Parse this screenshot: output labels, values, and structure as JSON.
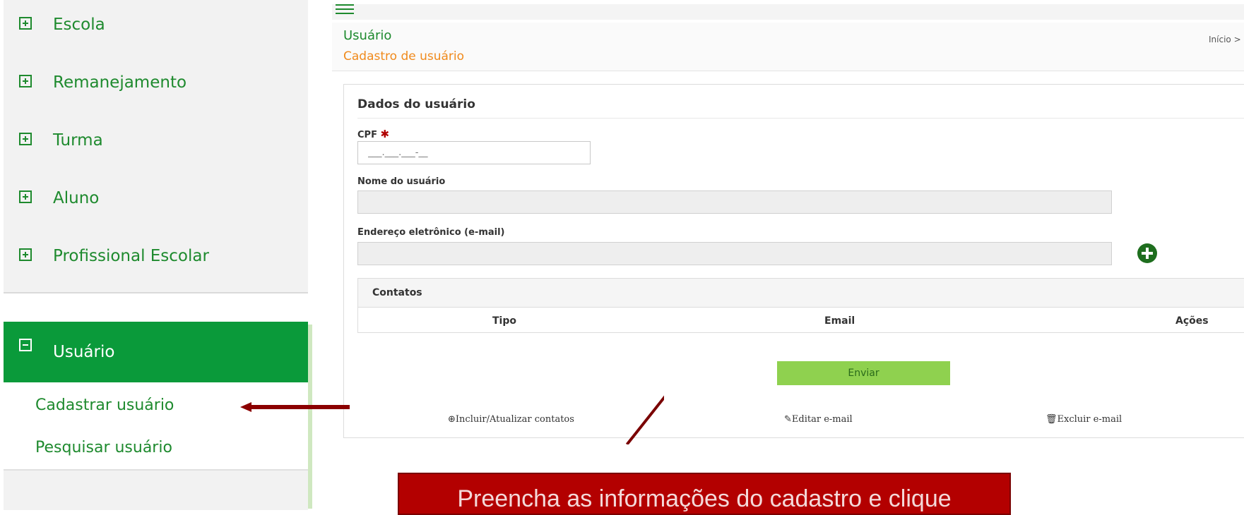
{
  "sidebar": {
    "items": [
      {
        "label": "Escola",
        "icon": "plus-square-icon"
      },
      {
        "label": "Remanejamento",
        "icon": "plus-square-icon"
      },
      {
        "label": "Turma",
        "icon": "plus-square-icon"
      },
      {
        "label": "Aluno",
        "icon": "plus-square-icon"
      },
      {
        "label": "Profissional Escolar",
        "icon": "plus-square-icon"
      },
      {
        "label": "Usuário",
        "icon": "minus-square-icon",
        "active": true
      }
    ],
    "submenu": [
      {
        "label": "Cadastrar usuário"
      },
      {
        "label": "Pesquisar usuário"
      }
    ]
  },
  "header": {
    "title": "Usuário",
    "subtitle": "Cadastro de usuário",
    "breadcrumb": "Início >"
  },
  "form": {
    "section_title": "Dados do usuário",
    "cpf_label": "CPF",
    "cpf_required_mark": "✱",
    "cpf_mask": "___.___.___-__",
    "name_label": "Nome do usuário",
    "email_label": "Endereço eletrônico (e-mail)"
  },
  "contacts": {
    "title": "Contatos",
    "columns": [
      "Tipo",
      "Email",
      "Ações"
    ]
  },
  "buttons": {
    "submit_label": "Enviar"
  },
  "actions": [
    {
      "icon": "plus-circle-icon",
      "label": "Incluir/Atualizar contatos"
    },
    {
      "icon": "pencil-icon",
      "label": "Editar e-mail"
    },
    {
      "icon": "trash-icon",
      "label": "Excluir e-mail"
    }
  ],
  "annotation": {
    "text": "Preencha as informações do cadastro e clique"
  },
  "colors": {
    "brand_green": "#0a9a3a",
    "button_green": "#8fd14f",
    "callout_red": "#b30000",
    "subtitle_orange": "#f08a1c"
  }
}
